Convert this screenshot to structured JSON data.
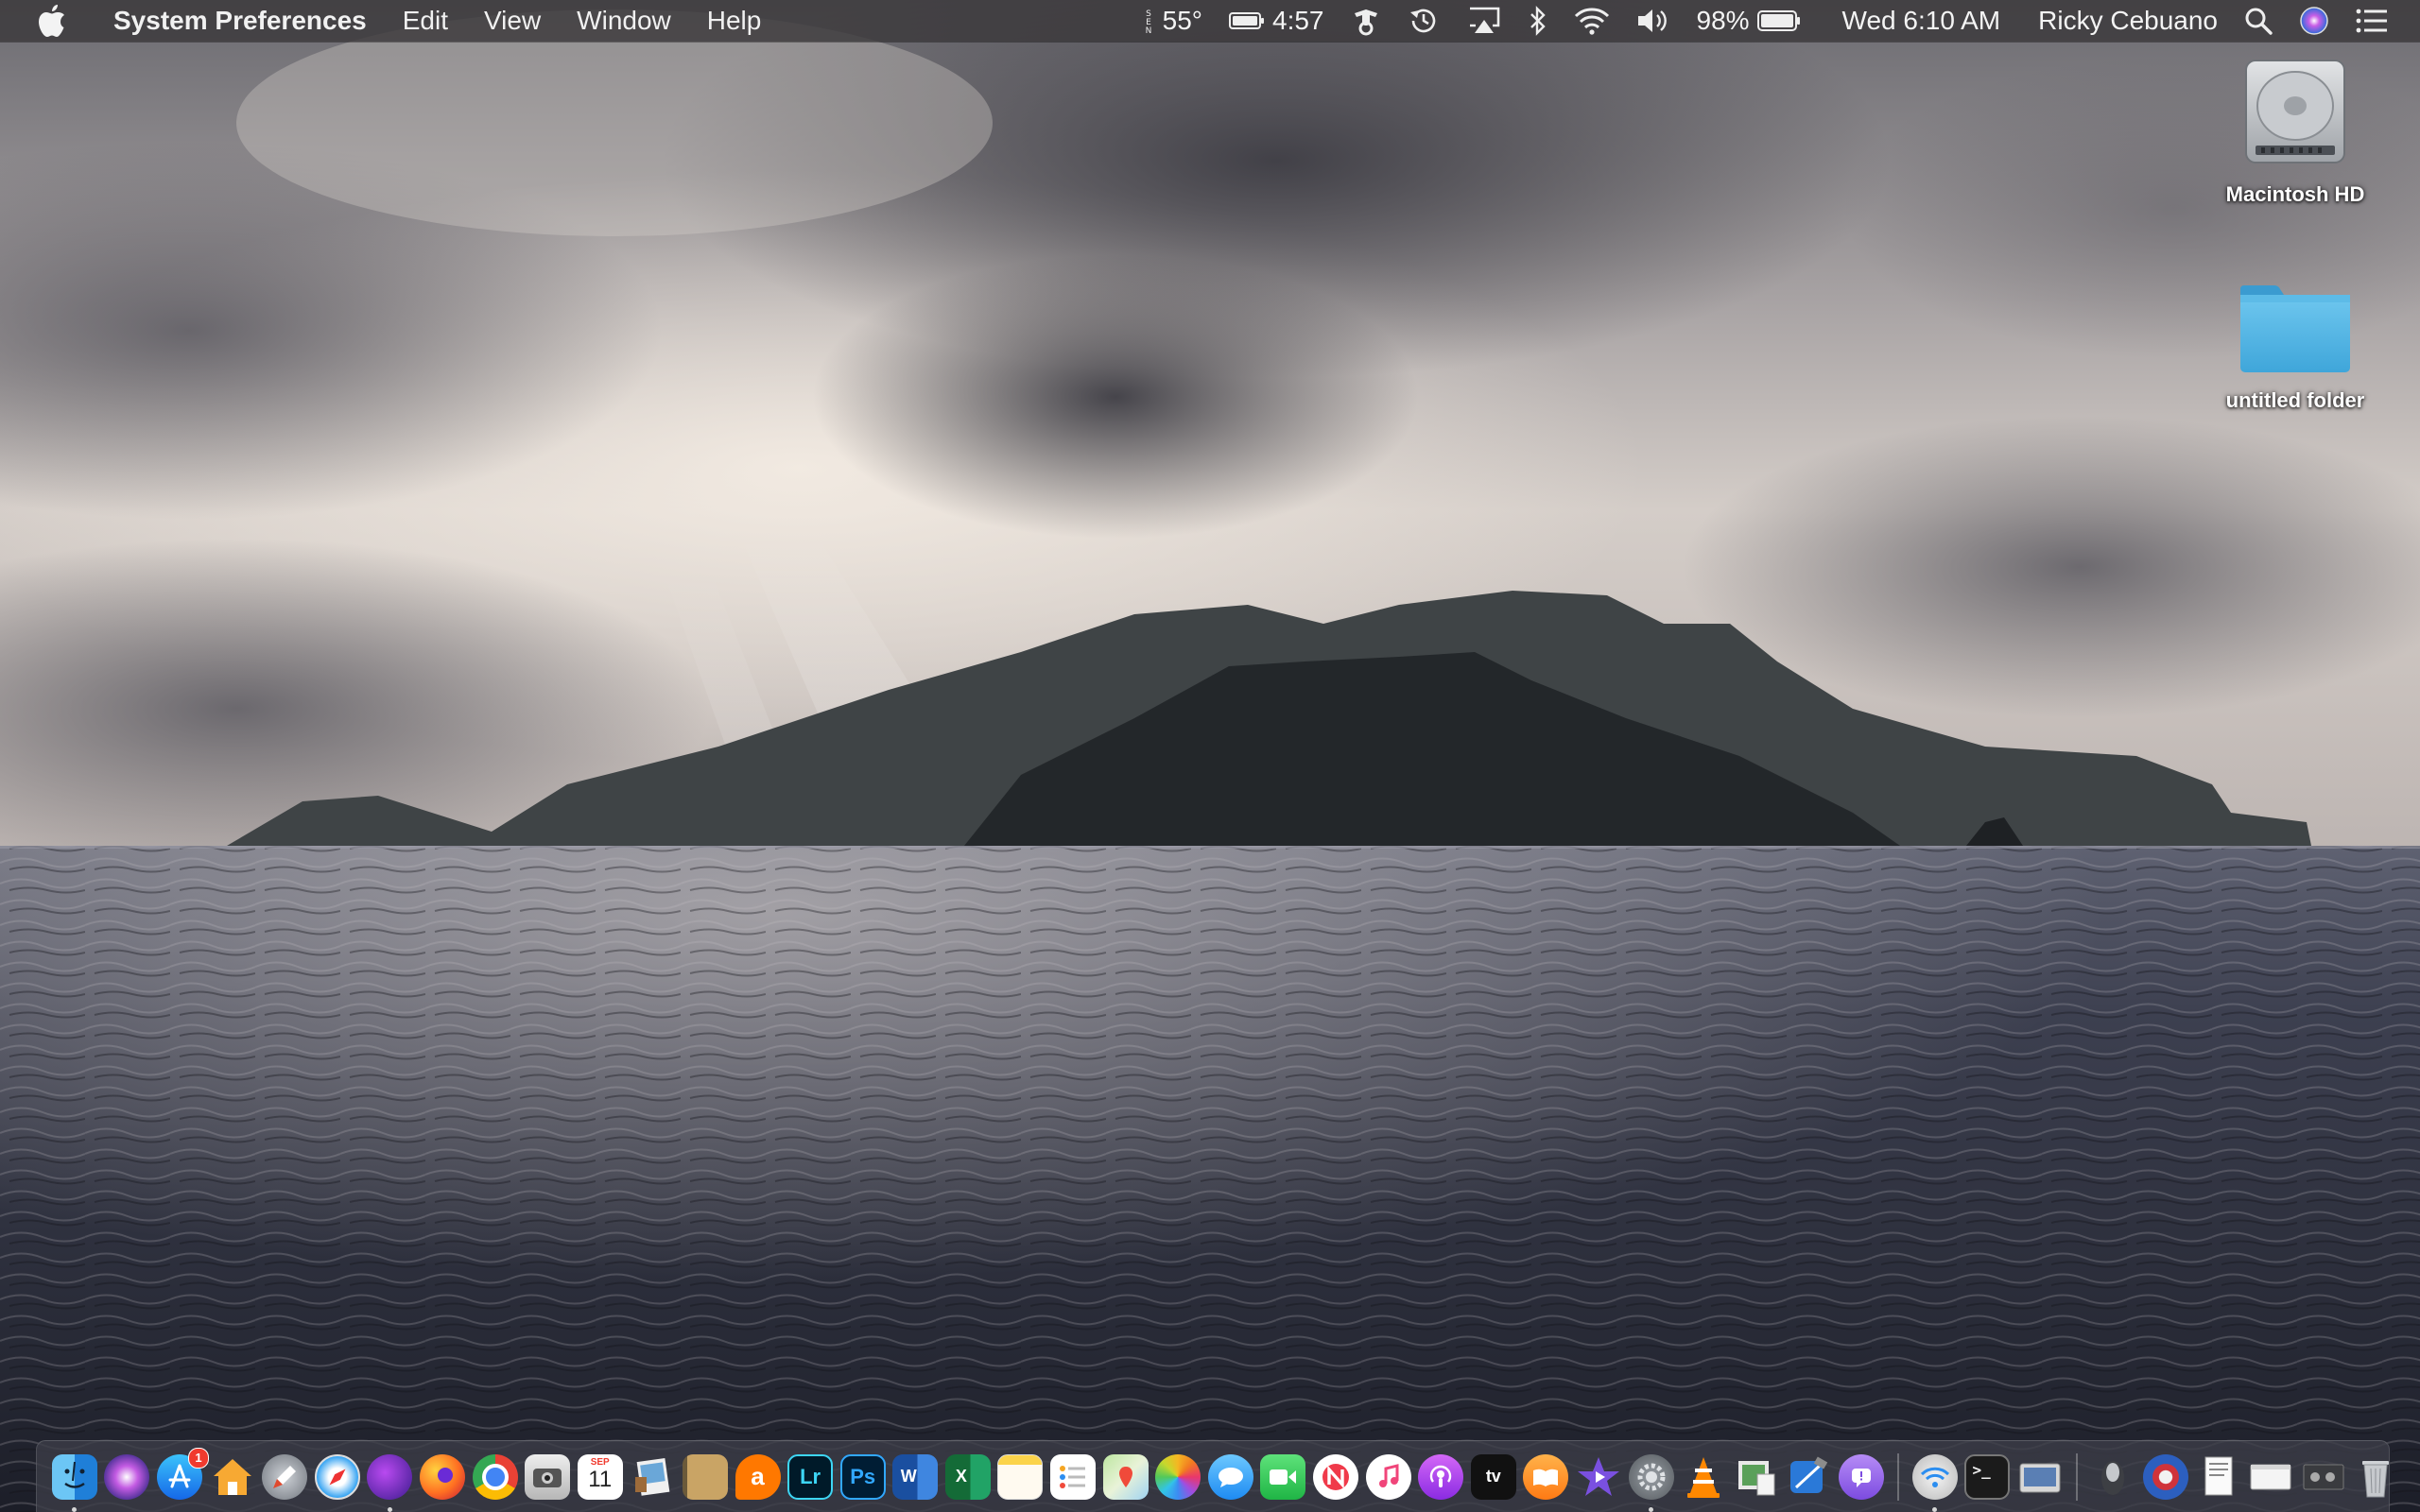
{
  "menubar": {
    "app_name": "System Preferences",
    "menus": [
      "Edit",
      "View",
      "Window",
      "Help"
    ],
    "status": {
      "weather_temp": "55°",
      "battery_time": "4:57",
      "battery_percent": "98%",
      "clock": "Wed 6:10 AM",
      "user_name": "Ricky Cebuano"
    }
  },
  "desktop_icons": [
    {
      "label": "Macintosh HD",
      "icon": "hard-drive-icon"
    },
    {
      "label": "untitled folder",
      "icon": "folder-icon"
    }
  ],
  "dock": {
    "calendar_month": "SEP",
    "calendar_day": "11",
    "app_store_badge": "1",
    "lightroom_label": "Lr",
    "photoshop_label": "Ps",
    "word_label": "W",
    "excel_label": "X",
    "appletv_label": "tv"
  }
}
